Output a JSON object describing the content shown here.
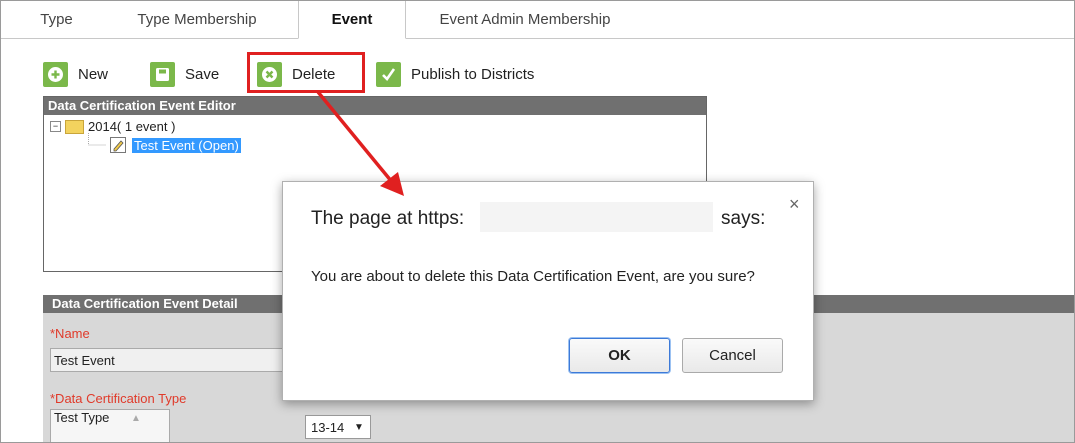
{
  "tabs": [
    {
      "label": "Type",
      "active": false
    },
    {
      "label": "Type Membership",
      "active": false
    },
    {
      "label": "Event",
      "active": true
    },
    {
      "label": "Event Admin Membership",
      "active": false
    }
  ],
  "toolbar": {
    "new_label": "New",
    "save_label": "Save",
    "delete_label": "Delete",
    "publish_label": "Publish to Districts",
    "accent_color": "#7bb84a",
    "highlight_color": "#e02020"
  },
  "editor": {
    "title": "Data Certification Event Editor",
    "tree": {
      "folder_label": "2014( 1 event )",
      "selected_node": "Test Event (Open)"
    }
  },
  "detail": {
    "title": "Data Certification Event Detail",
    "name_label": "*Name",
    "name_value": "Test Event",
    "type_label": "*Data Certification Type",
    "type_value": "Test Type",
    "year_value": "13-14"
  },
  "dialog": {
    "title_prefix": "The page at https:",
    "title_suffix": "says:",
    "message": "You are about to delete this Data Certification Event, are you sure?",
    "ok_label": "OK",
    "cancel_label": "Cancel",
    "close_glyph": "×"
  }
}
